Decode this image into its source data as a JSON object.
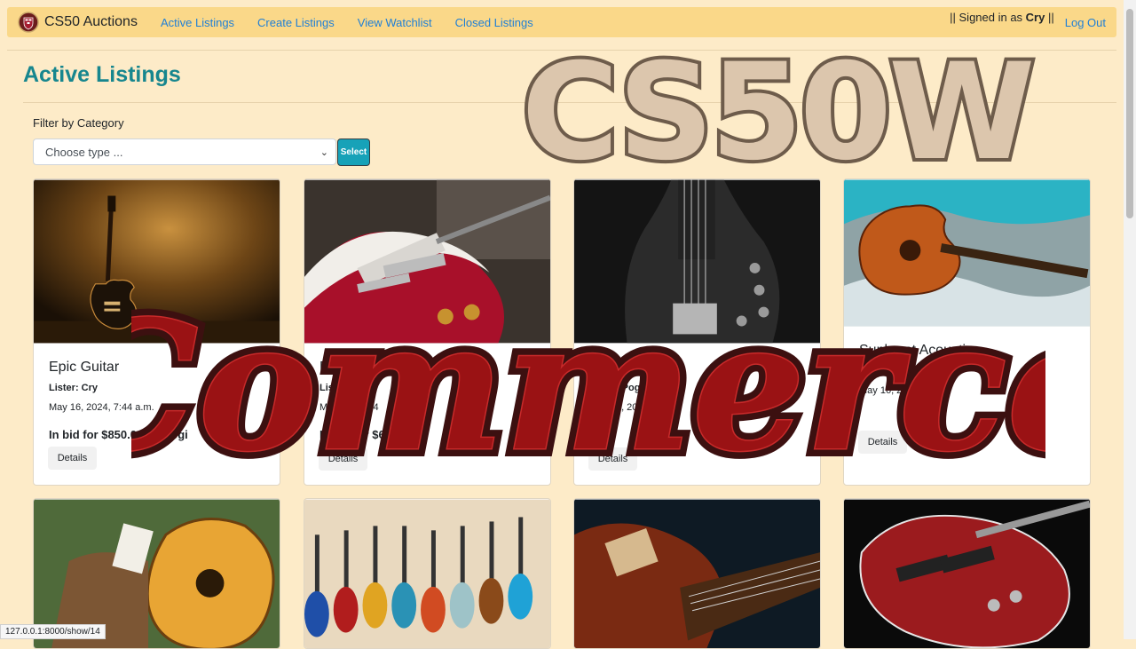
{
  "navbar": {
    "brand": "CS50 Auctions",
    "links": [
      "Active Listings",
      "Create Listings",
      "View Watchlist",
      "Closed Listings"
    ],
    "signed_prefix": "|| Signed in as ",
    "signed_user": "Cry",
    "signed_suffix": " ||",
    "logout": "Log Out"
  },
  "page": {
    "title": "Active Listings",
    "filter_label": "Filter by Category",
    "select_value": "Choose type ...",
    "select_button": "Select"
  },
  "listings": [
    {
      "title": "Epic Guitar",
      "lister": "Lister: Cry",
      "date": "May 16, 2024, 7:44 a.m.",
      "bid": "In bid for $850.00 by Pogi",
      "details": "Details"
    },
    {
      "title": "Red Hollow Guitar",
      "lister": "Lister: Pogi",
      "date": "May 16, 2024",
      "bid": "In bid for $680.00",
      "details": "Details"
    },
    {
      "title": "Fender Bass",
      "lister": "Lister: Pogi",
      "date": "May 16, 2024",
      "details": "Details"
    },
    {
      "title": "Sunburst Acoustic",
      "lister": "Lister: Pogi",
      "date": "May 16, 2024, 1",
      "details": "Details"
    }
  ],
  "overlay": {
    "logo_text": "CS50W",
    "script_text": "Commerce"
  },
  "status_bar": "127.0.0.1:8000/show/14",
  "colors": {
    "background": "#fdebc8",
    "navbar": "#fad889",
    "link": "#1f7fd6",
    "title": "#17868e",
    "select_button": "#17a2b8",
    "overlay_beige": "#dcc6ad",
    "overlay_brown": "#6e5c4b",
    "overlay_red": "#9a1214",
    "overlay_dark": "#3c1010"
  }
}
